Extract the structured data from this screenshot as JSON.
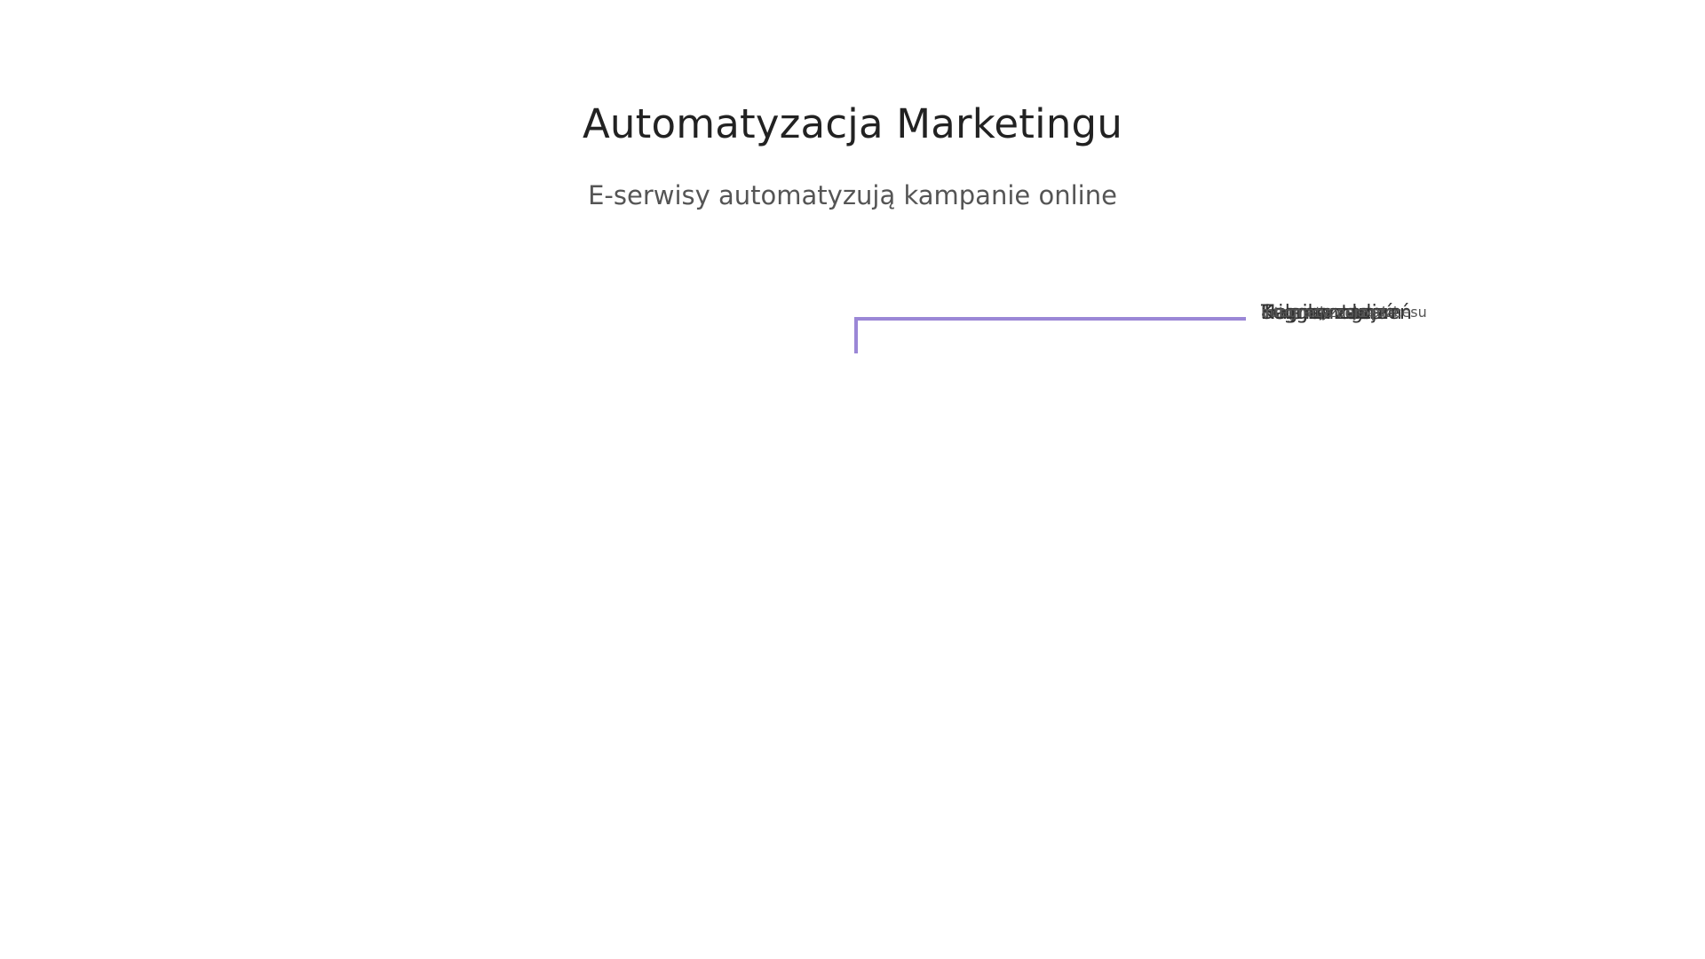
{
  "header": {
    "title": "Automatyzacja Marketingu",
    "subtitle": "E-serwisy automatyzują kampanie online"
  },
  "diagram": {
    "accent_color": "#9b87d6",
    "overlapping_labels": [
      {
        "text": "Kolejka zadań",
        "style": "main"
      },
      {
        "text": "Harmonogram",
        "style": "main"
      },
      {
        "text": "Trigger zdarzeń",
        "style": "main"
      },
      {
        "text": "Segmentacja",
        "style": "main"
      },
      {
        "text": "automatyzacja procesu",
        "style": "small"
      },
      {
        "text": "integracja narzędzi",
        "style": "small"
      }
    ]
  }
}
